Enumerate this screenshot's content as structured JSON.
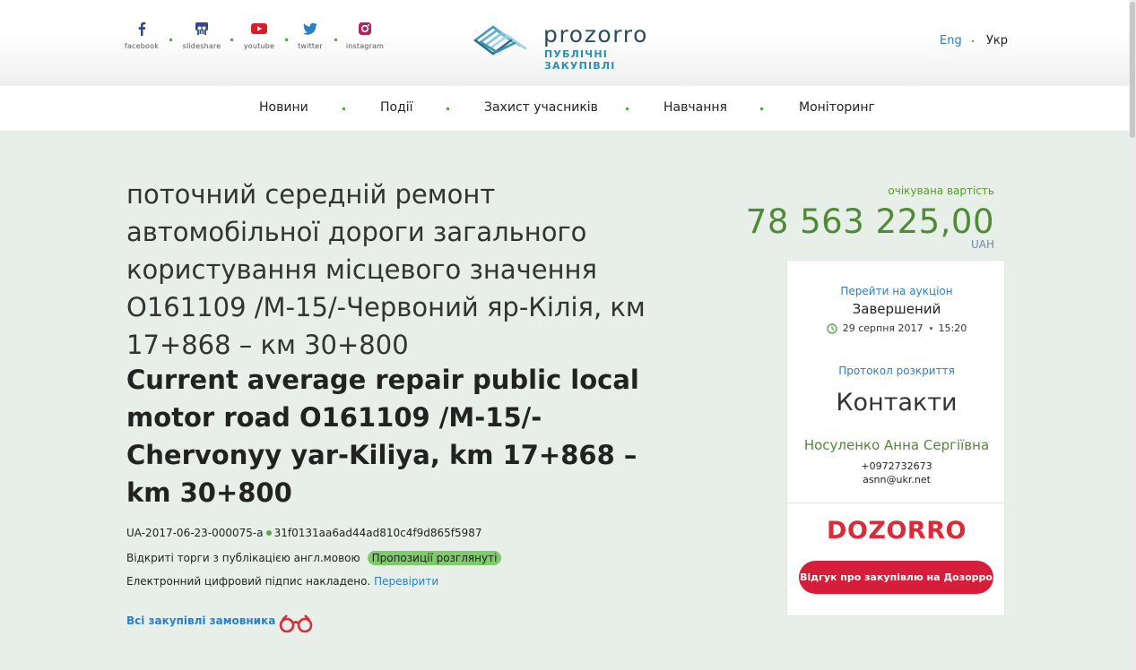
{
  "social": [
    {
      "label": "facebook",
      "icon": "facebook-icon"
    },
    {
      "label": "slideshare",
      "icon": "slideshare-icon"
    },
    {
      "label": "youtube",
      "icon": "youtube-icon"
    },
    {
      "label": "twitter",
      "icon": "twitter-icon"
    },
    {
      "label": "instagram",
      "icon": "instagram-icon"
    }
  ],
  "logo": {
    "word": "prozorro",
    "sub": "ПУБЛІЧНІ ЗАКУПІВЛІ"
  },
  "lang": {
    "en": "Eng",
    "uk": "Укр"
  },
  "nav": [
    "Новини",
    "Події",
    "Захист учасників",
    "Навчання",
    "Моніторинг"
  ],
  "tender": {
    "title_ua": "поточний середній ремонт автомобільної дороги загального користування місцевого значення О161109 /М-15/-Червоний яр-Кілія, км 17+868 – км 30+800",
    "title_en": "Current average repair public local motor road O161109 /M-15/-Chervonyy yar-Kiliya, km 17+868 – km 30+800",
    "id": "UA-2017-06-23-000075-a",
    "hash": "31f0131aa6ad44ad810c4f9d865f5987",
    "procedure": "Відкриті торги з публікацією англ.мовою",
    "status_badge": "Пропозиції розглянуті",
    "signature_text": "Електронний цифровий підпис накладено.",
    "verify_link": "Перевірити",
    "all_purchases": "Всі закупівлі замовника"
  },
  "expected": {
    "label": "очікувана вартість",
    "value": "78 563 225,00",
    "currency": "UAH"
  },
  "card": {
    "auction_link": "Перейти на аукціон",
    "auction_status": "Завершений",
    "auction_date": "29 серпня 2017",
    "auction_time": "15:20",
    "protocol_link": "Протокол розкриття",
    "contacts_heading": "Контакти",
    "contact_name": "Носуленко Анна Сергіївна",
    "contact_phone": "+0972732673",
    "contact_email": "asnn@ukr.net",
    "dozorro_logo": "DOZORRO",
    "dozorro_button": "Відгук про закупівлю на Дозорро"
  },
  "colors": {
    "accent_green": "#4f8a36",
    "link_blue": "#2b7fc3",
    "dozorro_red": "#d61e3a",
    "page_bg": "#e8efe9"
  }
}
